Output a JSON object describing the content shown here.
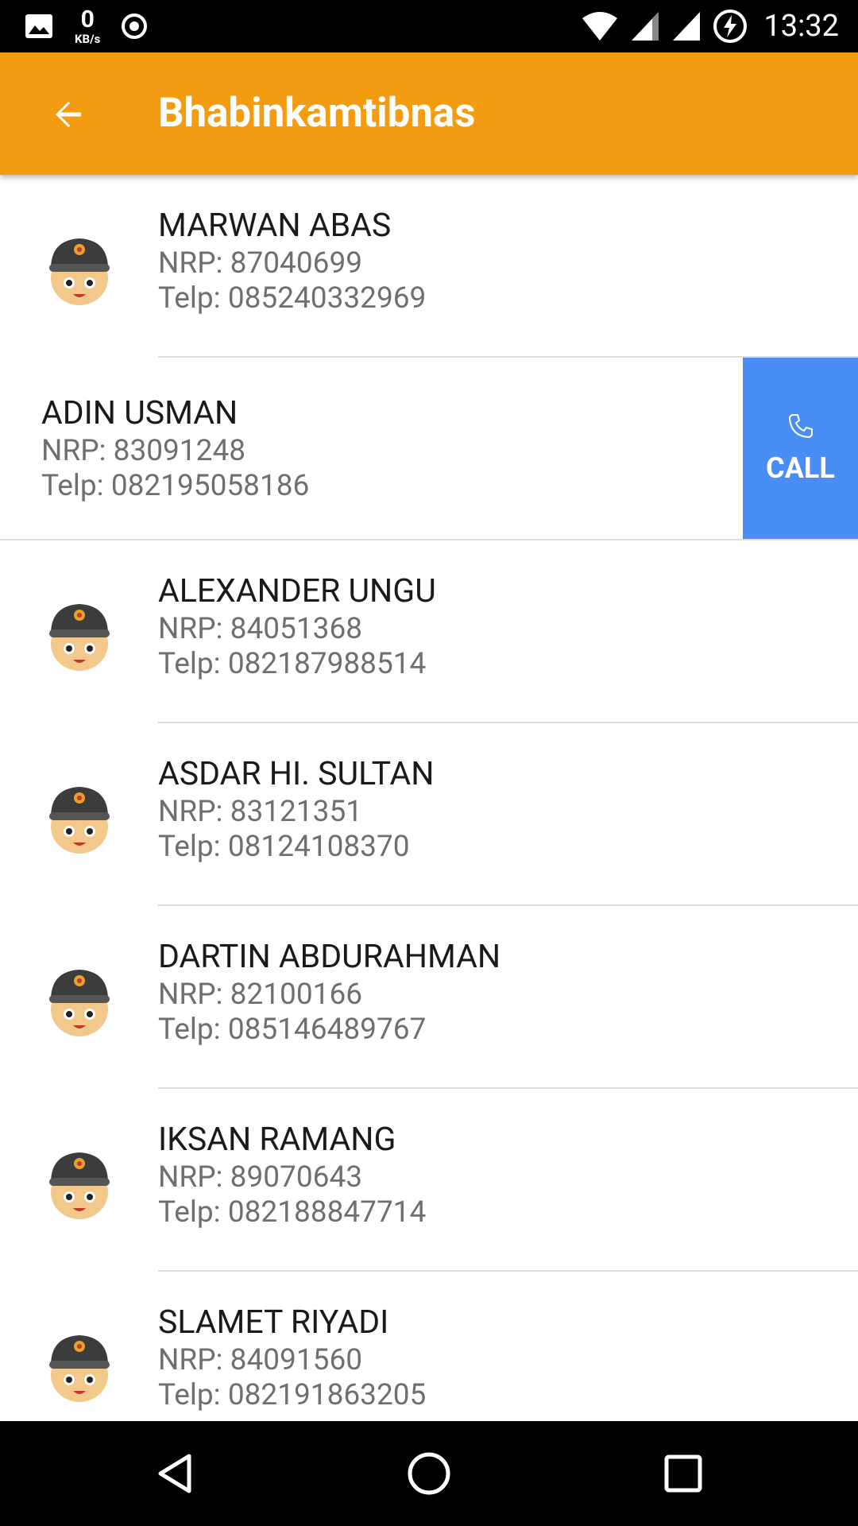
{
  "status_bar": {
    "net_speed_value": "0",
    "net_speed_unit": "KB/s",
    "time": "13:32",
    "icons": [
      "image-icon",
      "sync-icon",
      "wifi-icon",
      "signal-icon",
      "signal-icon",
      "battery-charging-icon"
    ]
  },
  "toolbar": {
    "title": "Bhabinkamtibnas",
    "back_icon": "arrow-back-icon",
    "color": "#f39c12"
  },
  "contacts": [
    {
      "name": "MARWAN ABAS",
      "nrp": "NRP: 87040699",
      "telp": "Telp: 085240332969"
    },
    {
      "name": "ADIN USMAN",
      "nrp": "NRP: 83091248",
      "telp": "Telp: 082195058186"
    },
    {
      "name": "ALEXANDER UNGU",
      "nrp": "NRP: 84051368",
      "telp": "Telp: 082187988514"
    },
    {
      "name": "ASDAR HI. SULTAN",
      "nrp": "NRP: 83121351",
      "telp": "Telp: 08124108370"
    },
    {
      "name": "DARTIN ABDURAHMAN",
      "nrp": "NRP: 82100166",
      "telp": "Telp: 085146489767"
    },
    {
      "name": "IKSAN RAMANG",
      "nrp": "NRP: 89070643",
      "telp": "Telp: 082188847714"
    },
    {
      "name": "SLAMET RIYADI",
      "nrp": "NRP: 84091560",
      "telp": "Telp: 082191863205"
    }
  ],
  "swipe_action": {
    "label": "CALL",
    "icon": "phone-icon",
    "color": "#4a8ef5"
  },
  "nav_bar": {
    "icons": [
      "nav-back-icon",
      "nav-home-icon",
      "nav-recents-icon"
    ]
  }
}
